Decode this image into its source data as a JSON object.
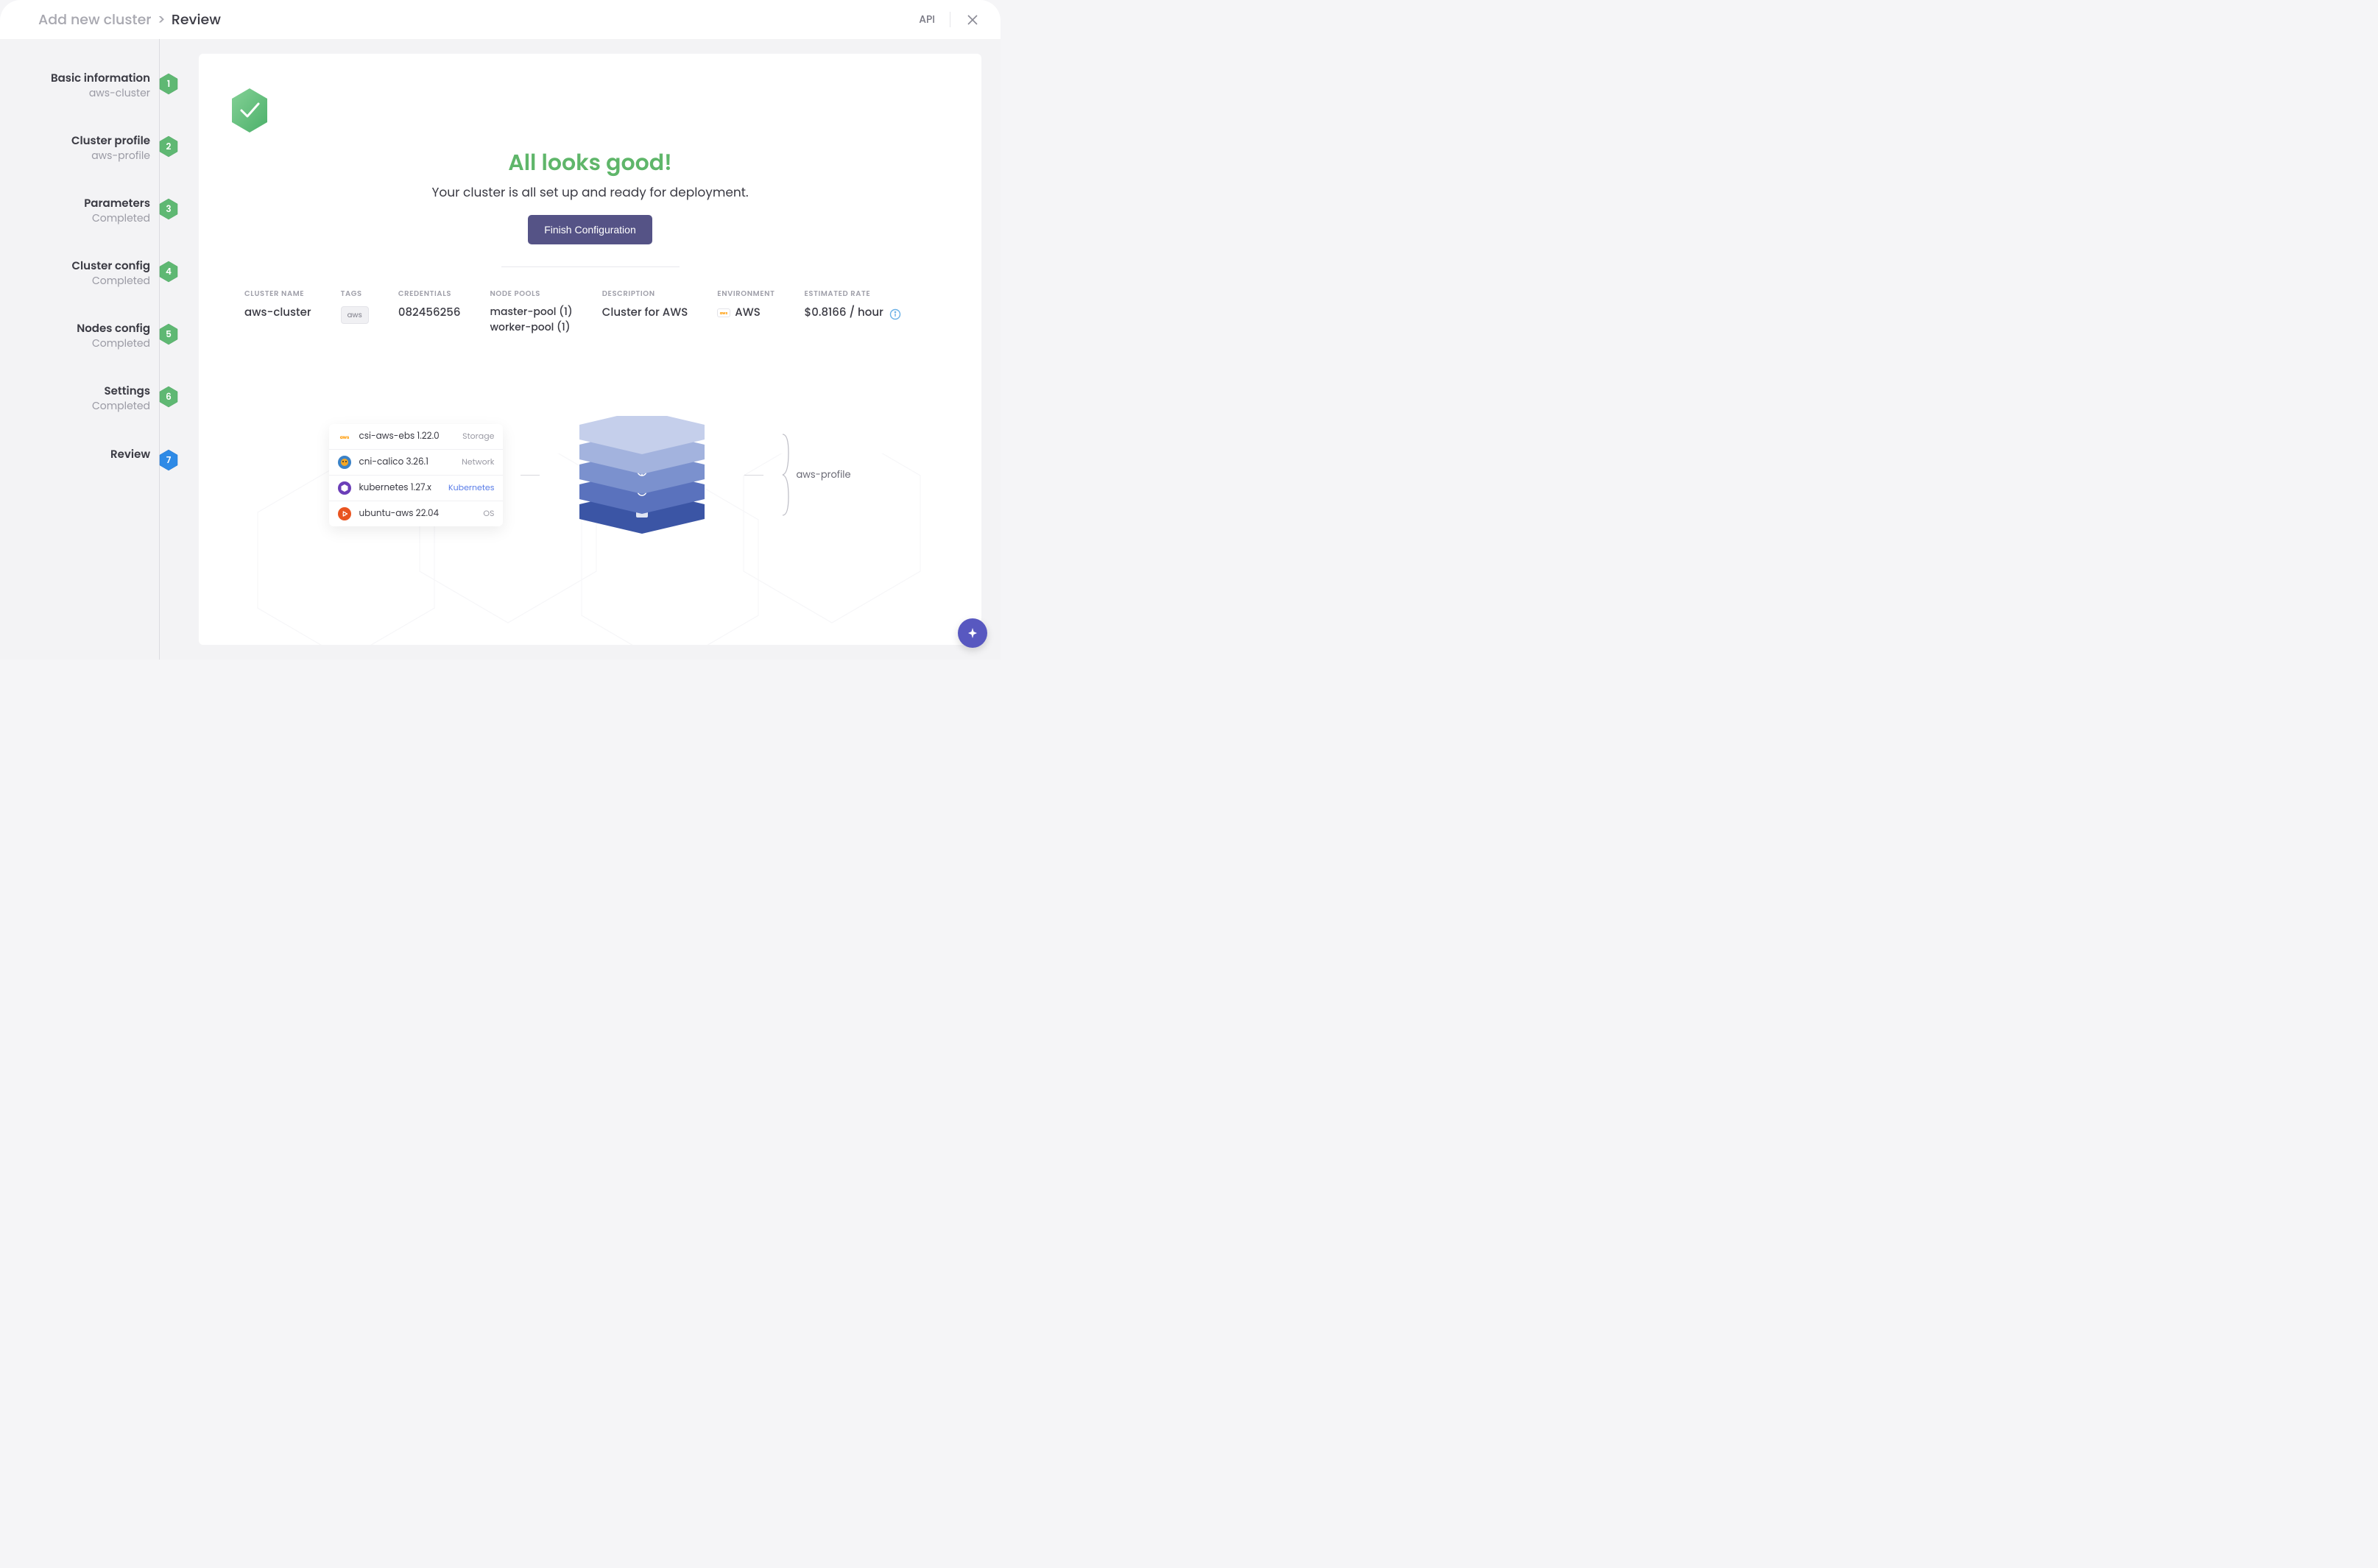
{
  "header": {
    "breadcrumb_parent": "Add new cluster",
    "breadcrumb_sep": ">",
    "breadcrumb_current": "Review",
    "api_link": "API"
  },
  "sidebar": {
    "steps": [
      {
        "title": "Basic information",
        "sub": "aws-cluster",
        "num": "1",
        "state": "done"
      },
      {
        "title": "Cluster profile",
        "sub": "aws-profile",
        "num": "2",
        "state": "done"
      },
      {
        "title": "Parameters",
        "sub": "Completed",
        "num": "3",
        "state": "done"
      },
      {
        "title": "Cluster config",
        "sub": "Completed",
        "num": "4",
        "state": "done"
      },
      {
        "title": "Nodes config",
        "sub": "Completed",
        "num": "5",
        "state": "done"
      },
      {
        "title": "Settings",
        "sub": "Completed",
        "num": "6",
        "state": "done"
      },
      {
        "title": "Review",
        "sub": "",
        "num": "7",
        "state": "current"
      }
    ]
  },
  "panel": {
    "success_title": "All looks good!",
    "success_sub": "Your cluster is all set up and ready for deployment.",
    "finish_btn": "Finish Configuration"
  },
  "summary": {
    "cluster_name_label": "CLUSTER NAME",
    "cluster_name": "aws-cluster",
    "tags_label": "TAGS",
    "tags": [
      "aws"
    ],
    "credentials_label": "CREDENTIALS",
    "credentials": "082456256",
    "node_pools_label": "NODE POOLS",
    "node_pools": [
      "master-pool (1)",
      "worker-pool (1)"
    ],
    "description_label": "DESCRIPTION",
    "description": "Cluster for AWS",
    "environment_label": "ENVIRONMENT",
    "environment": "AWS",
    "estimated_rate_label": "ESTIMATED RATE",
    "estimated_rate": "$0.8166 / hour"
  },
  "stack": {
    "layers": [
      {
        "name": "csi-aws-ebs 1.22.0",
        "type": "Storage",
        "icon": "aws",
        "typeColor": "gray"
      },
      {
        "name": "cni-calico 3.26.1",
        "type": "Network",
        "icon": "calico",
        "typeColor": "gray"
      },
      {
        "name": "kubernetes 1.27.x",
        "type": "Kubernetes",
        "icon": "k8s",
        "typeColor": "blue"
      },
      {
        "name": "ubuntu-aws 22.04",
        "type": "OS",
        "icon": "ubuntu",
        "typeColor": "gray"
      }
    ],
    "profile_name": "aws-profile"
  }
}
